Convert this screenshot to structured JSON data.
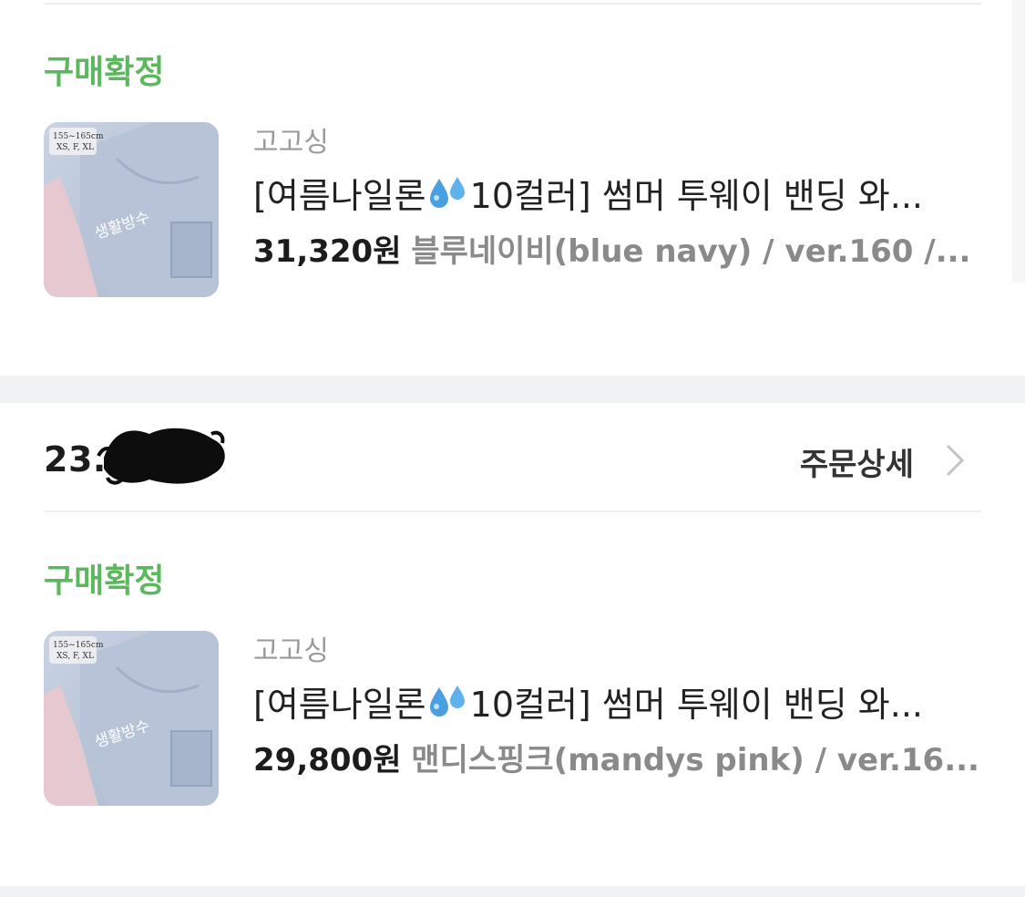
{
  "orders": [
    {
      "status": "구매확정",
      "seller": "고고싱",
      "title_before_icon": "[여름나일론",
      "title_icon": "sweat-droplets-emoji",
      "title_after_icon": "10컬러] 썸머 투웨이 밴딩 와...",
      "price": "31,320원",
      "option": "블루네이비(blue navy) / ver.160 /...",
      "thumb": {
        "size_tag_line1": "155~165cm",
        "size_tag_line2": "XS, F, XL",
        "overlay_text": "생활방수"
      }
    },
    {
      "date": "23.",
      "detail_label": "주문상세",
      "status": "구매확정",
      "seller": "고고싱",
      "title_before_icon": "[여름나일론",
      "title_icon": "sweat-droplets-emoji",
      "title_after_icon": "10컬러] 썸머 투웨이 밴딩 와...",
      "price": "29,800원",
      "option": "맨디스핑크(mandys pink) / ver.16...",
      "thumb": {
        "size_tag_line1": "155~165cm",
        "size_tag_line2": "XS, F, XL",
        "overlay_text": "생활방수"
      }
    }
  ],
  "colors": {
    "status_green": "#5cb85c",
    "divider": "#eeeeee",
    "gap": "#f1f2f4"
  }
}
